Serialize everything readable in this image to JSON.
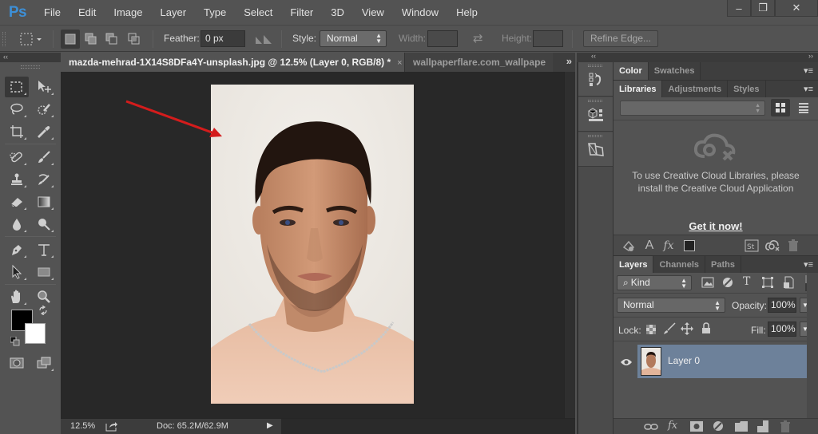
{
  "app": {
    "logo": "Ps",
    "menu": [
      "File",
      "Edit",
      "Image",
      "Layer",
      "Type",
      "Select",
      "Filter",
      "3D",
      "View",
      "Window",
      "Help"
    ],
    "window_controls": {
      "minimize": "–",
      "restore": "❐",
      "close": "✕"
    }
  },
  "options_bar": {
    "feather_label": "Feather:",
    "feather_value": "0 px",
    "style_label": "Style:",
    "style_value": "Normal",
    "width_label": "Width:",
    "width_value": "",
    "height_label": "Height:",
    "height_value": "",
    "refine_edge_label": "Refine Edge...",
    "swap_icon": "⇄"
  },
  "toolbar": {
    "collapse": "‹‹",
    "tools": [
      {
        "name": "rectangular-marquee",
        "active": true
      },
      {
        "name": "move"
      },
      {
        "name": "lasso"
      },
      {
        "name": "quick-selection"
      },
      {
        "name": "crop"
      },
      {
        "name": "eyedropper"
      },
      {
        "name": "spot-healing-brush"
      },
      {
        "name": "brush"
      },
      {
        "name": "clone-stamp"
      },
      {
        "name": "history-brush"
      },
      {
        "name": "eraser"
      },
      {
        "name": "gradient"
      },
      {
        "name": "blur"
      },
      {
        "name": "dodge"
      },
      {
        "name": "pen"
      },
      {
        "name": "type"
      },
      {
        "name": "path-selection"
      },
      {
        "name": "rectangle"
      },
      {
        "name": "hand"
      },
      {
        "name": "zoom"
      }
    ],
    "foreground_color": "#000000",
    "background_color": "#ffffff"
  },
  "document": {
    "tabs": [
      {
        "label": "mazda-mehrad-1X14S8DFa4Y-unsplash.jpg @ 12.5% (Layer 0, RGB/8) *",
        "close": "×",
        "active": true
      },
      {
        "label": "wallpaperflare.com_wallpape",
        "active": false
      }
    ],
    "overflow": "»",
    "annotation_arrow_color": "#d41c1c"
  },
  "status": {
    "zoom": "12.5%",
    "doc_size": "Doc: 65.2M/62.9M",
    "menu_arrow": "▶"
  },
  "panels": {
    "collapse": "‹‹",
    "expand": "››",
    "color_group": {
      "tabs": [
        "Color",
        "Swatches"
      ],
      "active": "Color"
    },
    "libraries_group": {
      "tabs": [
        "Libraries",
        "Adjustments",
        "Styles"
      ],
      "active": "Libraries",
      "message": "To use Creative Cloud Libraries, please install the Creative Cloud Application",
      "cta": "Get it now!"
    },
    "layers_group": {
      "tabs": [
        "Layers",
        "Channels",
        "Paths"
      ],
      "active": "Layers",
      "filter_kind": "Kind",
      "blend_mode": "Normal",
      "opacity_label": "Opacity:",
      "opacity": "100%",
      "lock_label": "Lock:",
      "fill_label": "Fill:",
      "fill": "100%",
      "layers": [
        {
          "name": "Layer 0",
          "visible": true,
          "selected": true
        }
      ]
    },
    "selected_layer_color": "#6d819a",
    "menu_icon": "▾≡"
  }
}
